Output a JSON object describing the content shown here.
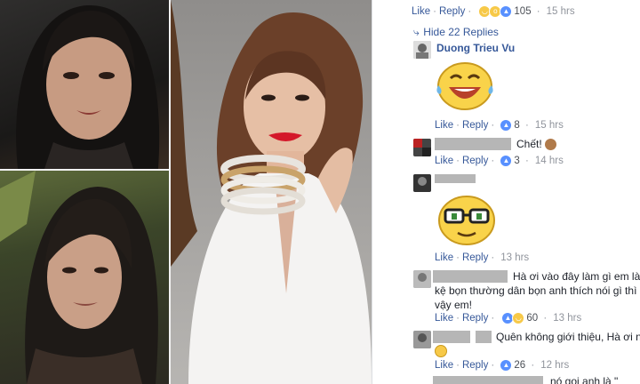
{
  "comments": [
    {
      "like": "Like",
      "reply": "Reply",
      "count": "105",
      "time": "15 hrs"
    },
    {
      "hide_replies": "Hide 22 Replies"
    },
    {
      "author": "Duong Trieu Vu",
      "like": "Like",
      "reply": "Reply",
      "count": "8",
      "time": "15 hrs"
    },
    {
      "text": "Chết!",
      "like": "Like",
      "reply": "Reply",
      "count": "3",
      "time": "14 hrs"
    },
    {
      "like": "Like",
      "reply": "Reply",
      "time": "13 hrs"
    },
    {
      "line1": "Hà ơi vào đây làm gì em là sao em",
      "line2": "kệ bọn thường dân bọn anh thích nói gì thì nói ch",
      "line3": "vậy em!",
      "like": "Like",
      "reply": "Reply",
      "count": "60",
      "time": "13 hrs"
    },
    {
      "line1": "Quên không giới thiệu, Hà ơi nhà a",
      "like": "Like",
      "reply": "Reply",
      "count": "26",
      "time": "12 hrs"
    },
    {
      "line1": "nó gọi anh là \""
    }
  ],
  "colors": {
    "link": "#365899",
    "meta": "#90949c",
    "text": "#1d2129"
  }
}
